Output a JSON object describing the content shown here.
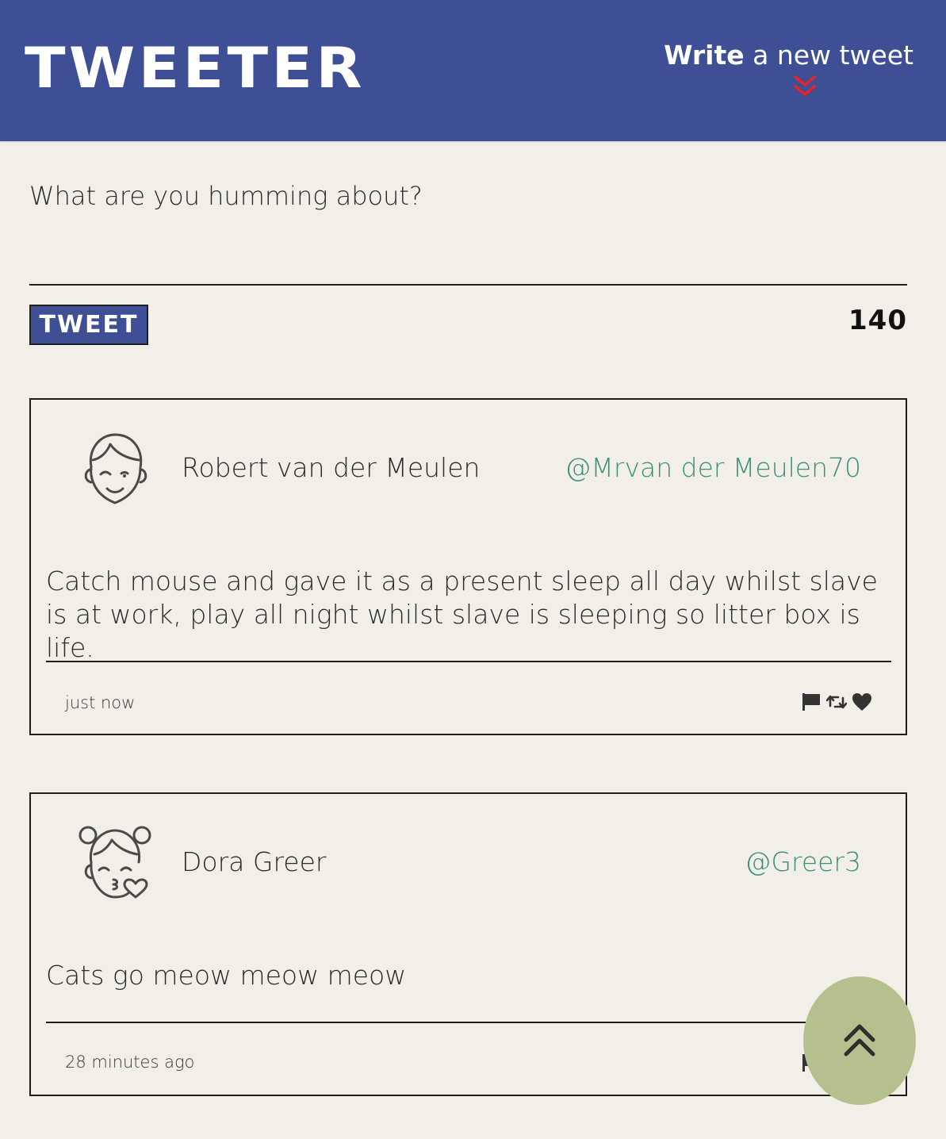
{
  "header": {
    "brand": "TWEETER",
    "compose_toggle": {
      "bold": "Write",
      "rest": " a new tweet"
    }
  },
  "new_tweet": {
    "placeholder": "What are you humming about?",
    "button_label": "TWEET",
    "counter": "140"
  },
  "tweets": [
    {
      "name": "Robert van der Meulen",
      "handle": "@Mrvan der Meulen70",
      "avatar_icon": "boy-face-icon",
      "content": "Catch mouse and gave it as a present sleep all day whilst slave is at work, play all night whilst slave is sleeping so litter box is life.",
      "timestamp": "just now",
      "actions": [
        "flag-icon",
        "retweet-icon",
        "heart-icon"
      ]
    },
    {
      "name": "Dora Greer",
      "handle": "@Greer3",
      "avatar_icon": "girl-kiss-face-icon",
      "content": "Cats go meow meow meow",
      "timestamp": "28 minutes ago",
      "actions": [
        "flag-icon",
        "retweet-icon",
        "heart-icon"
      ]
    }
  ],
  "scroll_top": {
    "icon": "double-chevron-up-icon"
  },
  "colors": {
    "nav": "#3e4f95",
    "background": "#f2efe9",
    "handle": "#3d8f77",
    "accent_chevron": "#e8232a",
    "scroll_button": "#b6c08f"
  }
}
